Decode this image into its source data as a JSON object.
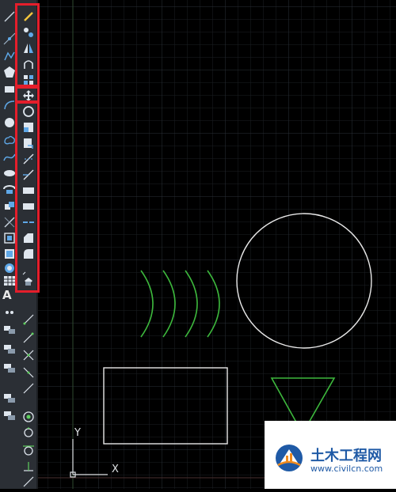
{
  "toolbars": {
    "draw": {
      "icons": [
        "line-icon",
        "construction-line-icon",
        "polyline-icon",
        "polygon-icon",
        "rectangle-icon",
        "arc-icon",
        "circle-icon",
        "revision-cloud-icon",
        "spline-icon",
        "ellipse-icon",
        "ellipse-arc-icon",
        "insert-block-icon",
        "make-block-icon",
        "point-icon",
        "hatch-icon",
        "gradient-icon",
        "region-icon",
        "table-icon",
        "multiline-text-icon",
        "add-selected-icon"
      ],
      "text_tool": "A"
    },
    "modify": {
      "icons": [
        "erase-icon",
        "copy-icon",
        "mirror-icon",
        "offset-icon",
        "array-icon",
        "move-icon",
        "rotate-icon",
        "scale-icon",
        "stretch-icon",
        "trim-icon",
        "extend-icon",
        "break-at-point-icon",
        "break-icon",
        "join-icon",
        "chamfer-icon",
        "fillet-icon",
        "blend-curves-icon",
        "explode-icon"
      ]
    },
    "colors": {
      "highlight": "#e41e2b"
    }
  },
  "ucs": {
    "y_label": "Y",
    "x_label": "X"
  },
  "watermark": {
    "name": "土木工程网",
    "url": "www.civilcn.com"
  }
}
